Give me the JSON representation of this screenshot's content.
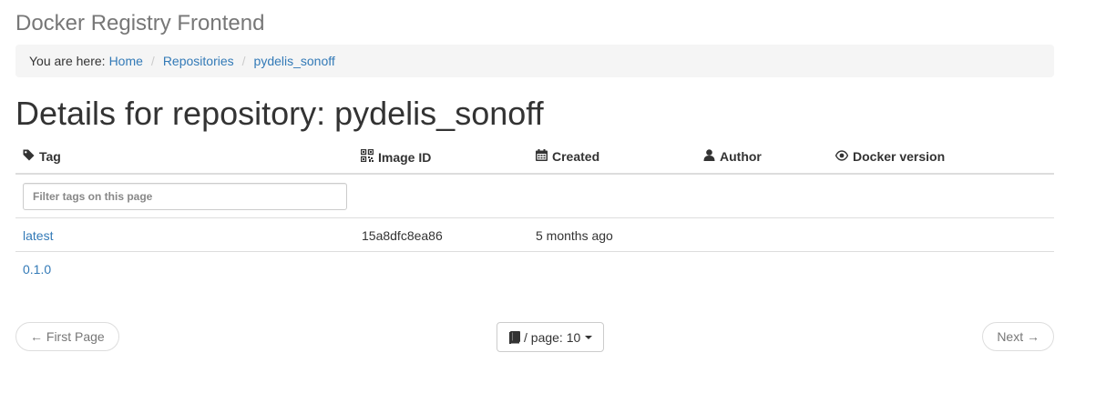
{
  "app": {
    "title": "Docker Registry Frontend"
  },
  "breadcrumb": {
    "prefix": "You are here:",
    "items": [
      {
        "label": "Home"
      },
      {
        "label": "Repositories"
      },
      {
        "label": "pydelis_sonoff"
      }
    ],
    "separator": "/"
  },
  "heading": "Details for repository: pydelis_sonoff",
  "table": {
    "columns": [
      {
        "label": "Tag",
        "icon": "tag-icon"
      },
      {
        "label": "Image ID",
        "icon": "qrcode-icon"
      },
      {
        "label": "Created",
        "icon": "calendar-icon"
      },
      {
        "label": "Author",
        "icon": "user-icon"
      },
      {
        "label": "Docker version",
        "icon": "eye-icon"
      }
    ],
    "filter": {
      "placeholder": "Filter tags on this page",
      "value": ""
    },
    "rows": [
      {
        "tag": "latest",
        "image_id": "15a8dfc8ea86",
        "created": "5 months ago",
        "author": "",
        "docker_version": ""
      },
      {
        "tag": "0.1.0",
        "image_id": "",
        "created": "",
        "author": "",
        "docker_version": ""
      }
    ]
  },
  "pager": {
    "first_label": "← First Page",
    "per_page_label": "/ page: 10",
    "per_page_icon": "book-icon",
    "next_label": "Next →"
  },
  "colors": {
    "link": "#337ab7",
    "muted": "#777777",
    "breadcrumb_bg": "#f5f5f5",
    "border": "#dddddd"
  }
}
